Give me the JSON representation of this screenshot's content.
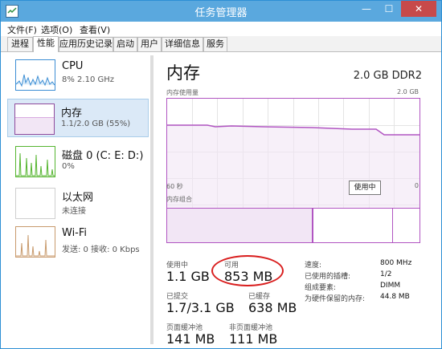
{
  "window": {
    "title": "任务管理器",
    "min": "—",
    "max": "☐",
    "close": "✕"
  },
  "menubar": [
    "文件(F)",
    "选项(O)",
    "查看(V)"
  ],
  "tabs": [
    "进程",
    "性能",
    "应用历史记录",
    "启动",
    "用户",
    "详细信息",
    "服务"
  ],
  "sidebar": [
    {
      "name": "CPU",
      "sub": "8% 2.10 GHz",
      "border": "#3c8ed4"
    },
    {
      "name": "内存",
      "sub": "1.1/2.0 GB (55%)",
      "border": "#8f4a9c"
    },
    {
      "name": "磁盘 0 (C: E: D:)",
      "sub": "0%",
      "border": "#55b52f"
    },
    {
      "name": "以太网",
      "sub": "未连接",
      "border": "#d0b18a"
    },
    {
      "name": "Wi-Fi",
      "sub": "发送: 0 接收: 0 Kbps",
      "border": "#c89a6c"
    }
  ],
  "main": {
    "title": "内存",
    "spec": "2.0 GB DDR2",
    "usage_label": "内存使用量",
    "usage_max": "2.0 GB",
    "x_left": "60 秒",
    "x_right": "0",
    "composition_label": "内存组合",
    "tooltip": "使用中"
  },
  "stats": {
    "in_use_label": "使用中",
    "in_use_value": "1.1 GB",
    "available_label": "可用",
    "available_value": "853 MB",
    "committed_label": "已提交",
    "committed_value": "1.7/3.1 GB",
    "cached_label": "已缓存",
    "cached_value": "638 MB",
    "paged_label": "页面缓冲池",
    "paged_value": "141 MB",
    "nonpaged_label": "非页面缓冲池",
    "nonpaged_value": "111 MB"
  },
  "details": [
    {
      "label": "速度:",
      "value": "800 MHz"
    },
    {
      "label": "已使用的插槽:",
      "value": "1/2"
    },
    {
      "label": "组成要素:",
      "value": "DIMM"
    },
    {
      "label": "为硬件保留的内存:",
      "value": "44.8 MB"
    }
  ],
  "colors": {
    "memory_accent": "#b155c2",
    "memory_fill": "#f2e6f5",
    "annotation": "#d91e1e"
  }
}
